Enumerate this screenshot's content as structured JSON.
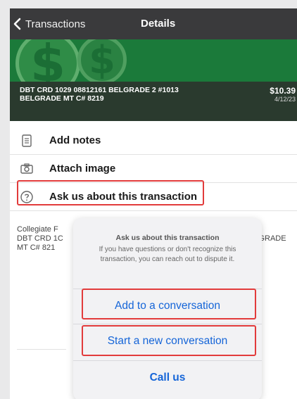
{
  "nav": {
    "back_label": "Transactions",
    "title": "Details"
  },
  "transaction": {
    "description_line1": "DBT CRD 1029 08812161 BELGRADE 2 #1013",
    "description_line2": "BELGRADE MT C# 8219",
    "amount": "$10.39",
    "date": "4/12/23"
  },
  "actions": [
    {
      "label": "Add notes",
      "icon": "notes-icon"
    },
    {
      "label": "Attach image",
      "icon": "camera-icon"
    },
    {
      "label": "Ask us about this transaction",
      "icon": "question-circle-icon"
    }
  ],
  "merchant": {
    "line1": "Collegiate F",
    "line2": "DBT CRD 1C",
    "line3": "MT C# 821",
    "right_text": "ELGRADE"
  },
  "sheet": {
    "title": "Ask us about this transaction",
    "message": "If you have questions or don't recognize this transaction, you can reach out to dispute it.",
    "buttons": [
      {
        "label": "Add to a conversation"
      },
      {
        "label": "Start a new conversation"
      },
      {
        "label": "Call us"
      }
    ]
  },
  "colors": {
    "highlight": "#e23b3b",
    "link": "#1565d8",
    "navbar": "#3a3a3c",
    "green": "#1b7a3a"
  }
}
